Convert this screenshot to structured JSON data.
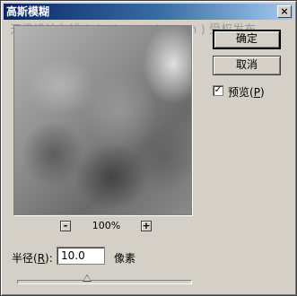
{
  "window": {
    "title": "高斯模糊",
    "close_glyph": "×"
  },
  "watermark": "天极设计在线 ( design.yesky.com ) 受权发布",
  "preview": {
    "zoom_level": "100%",
    "zoom_out": "-",
    "zoom_in": "+"
  },
  "buttons": {
    "ok": "确定",
    "cancel": "取消"
  },
  "preview_option": {
    "checked": true,
    "check_glyph": "✓",
    "label": "预览",
    "mnemonic": "P"
  },
  "radius": {
    "label": "半径",
    "mnemonic": "R",
    "value": "10.0",
    "unit": "像素"
  },
  "slider": {
    "level": 0.4
  }
}
